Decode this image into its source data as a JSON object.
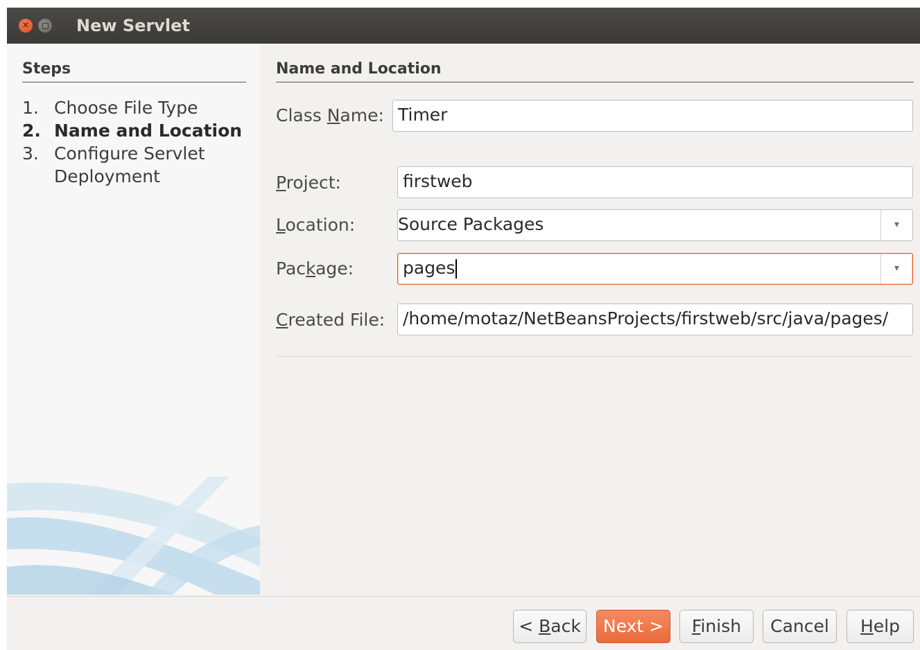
{
  "window": {
    "title": "New Servlet",
    "close_glyph": "×"
  },
  "steps": {
    "heading": "Steps",
    "items": [
      {
        "num": "1.",
        "label": "Choose File Type"
      },
      {
        "num": "2.",
        "label": "Name and Location"
      },
      {
        "num": "3.",
        "label": "Configure Servlet",
        "label_cont": "Deployment"
      }
    ],
    "current_index": 1
  },
  "main": {
    "section_title": "Name and Location",
    "fields": {
      "class_name": {
        "label_pre": "Class ",
        "label_mnemonic": "N",
        "label_post": "ame:",
        "value": "Timer"
      },
      "project": {
        "label_pre": "",
        "label_mnemonic": "P",
        "label_post": "roject:",
        "value": "firstweb"
      },
      "location": {
        "label_pre": "",
        "label_mnemonic": "L",
        "label_post": "ocation:",
        "value": "Source Packages"
      },
      "package": {
        "label_pre": "Pac",
        "label_mnemonic": "k",
        "label_post": "age:",
        "value": "pages"
      },
      "created_file": {
        "label_pre": "",
        "label_mnemonic": "C",
        "label_post": "reated File:",
        "value": "/home/motaz/NetBeansProjects/firstweb/src/java/pages/"
      }
    },
    "combo_arrow": "▾"
  },
  "buttons": {
    "back": {
      "pre": "< ",
      "mnemonic": "B",
      "post": "ack"
    },
    "next": {
      "label": "Next >"
    },
    "finish": {
      "pre": "",
      "mnemonic": "F",
      "post": "inish"
    },
    "cancel": {
      "label": "Cancel"
    },
    "help": {
      "pre": "",
      "mnemonic": "H",
      "post": "elp"
    }
  },
  "colors": {
    "accent": "#e96b3c",
    "titlebar": "#3b3a36",
    "panel_bg": "#f2f1f0"
  }
}
